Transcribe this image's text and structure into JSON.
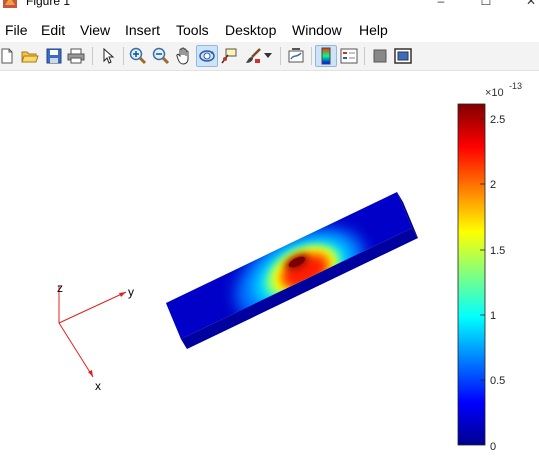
{
  "window": {
    "title": "Figure 1",
    "controls": [
      "minimize-icon",
      "maximize-icon",
      "close-icon"
    ]
  },
  "menu": {
    "items": [
      "File",
      "Edit",
      "View",
      "Insert",
      "Tools",
      "Desktop",
      "Window",
      "Help"
    ]
  },
  "toolbar": {
    "buttons": [
      "new-figure-icon",
      "open-file-icon",
      "save-icon",
      "print-icon",
      "edit-plot-arrow-icon",
      "zoom-in-icon",
      "zoom-out-icon",
      "pan-hand-icon",
      "rotate-3d-icon",
      "data-cursor-icon",
      "brush-icon",
      "brush-dropdown-icon",
      "link-plot-icon",
      "insert-colorbar-icon",
      "insert-legend-icon",
      "hide-plot-tools-icon",
      "show-plot-tools-icon"
    ],
    "active": [
      "rotate-3d-icon",
      "insert-colorbar-icon"
    ]
  },
  "axes_triad": {
    "labels": {
      "x": "x",
      "y": "y",
      "z": "z"
    },
    "color": "#e02020"
  },
  "colorbar": {
    "exponent_base": "×10",
    "exponent_power": "-13",
    "tick_labels": [
      "2.5",
      "2",
      "1.5",
      "1",
      "0.5",
      "0"
    ],
    "colormap": "jet",
    "range": [
      0,
      2.6e-13
    ]
  },
  "chart_data": {
    "type": "heatmap",
    "description_values": {
      "field": "3D beam surface coloured by scalar value",
      "min": 0,
      "max": 2.6e-13,
      "hotspot": "dark red near centre of top face"
    },
    "colorbar_ticks": [
      0,
      5e-14,
      1e-13,
      1.5e-13,
      2e-13,
      2.5e-13
    ]
  }
}
